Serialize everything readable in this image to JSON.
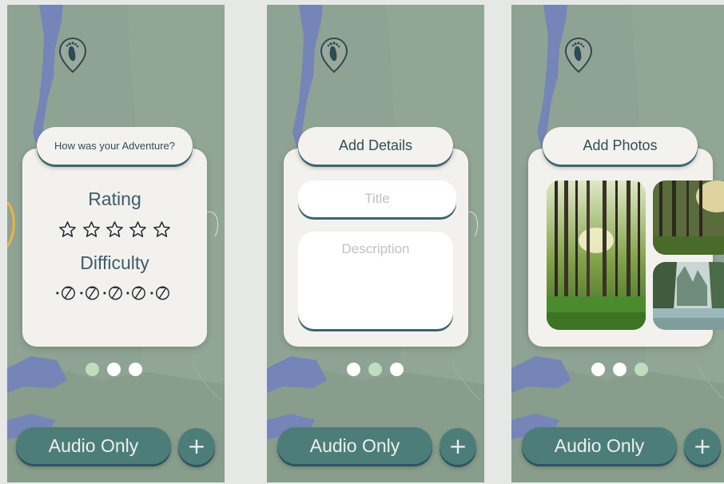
{
  "screens": [
    {
      "header": "How was your Adventure?",
      "rating_label": "Rating",
      "difficulty_label": "Difficulty",
      "rating_value": 0,
      "rating_max": 5,
      "difficulty_value": 0,
      "difficulty_max": 5,
      "active_dot": 0
    },
    {
      "header": "Add Details",
      "title_placeholder": "Title",
      "description_placeholder": "Description",
      "active_dot": 1
    },
    {
      "header": "Add Photos",
      "photos": [
        "forest-photo",
        "forest-sunlight-photo",
        "forest-river-photo"
      ],
      "active_dot": 2
    }
  ],
  "bottom_bar": {
    "audio_label": "Audio Only",
    "add_label": "+"
  },
  "pin_icon": "footprint-pin-icon",
  "colors": {
    "map_green": "#8ea393",
    "water_blue": "#7585b8",
    "card_bg": "#f3f1ed",
    "accent_teal": "#4d7d79",
    "text_teal": "#3c5e6a",
    "dot_active": "#bfdcbf"
  }
}
